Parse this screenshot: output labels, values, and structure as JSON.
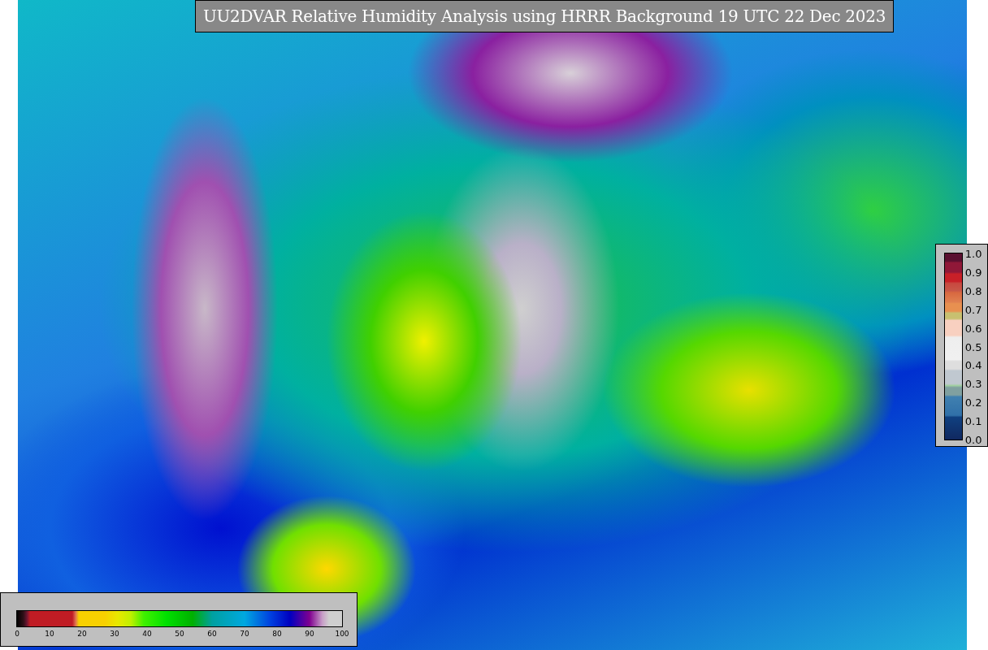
{
  "title": "UU2DVAR Relative Humidity Analysis using HRRR Background 19 UTC 22 Dec 2023",
  "humidity_colorbar": {
    "ticks": [
      "0",
      "10",
      "20",
      "30",
      "40",
      "50",
      "60",
      "70",
      "80",
      "90",
      "100"
    ]
  },
  "observation_colorbar": {
    "ticks": [
      "1.0",
      "0.9",
      "0.8",
      "0.7",
      "0.6",
      "0.5",
      "0.4",
      "0.3",
      "0.2",
      "0.1",
      "0.0"
    ]
  }
}
